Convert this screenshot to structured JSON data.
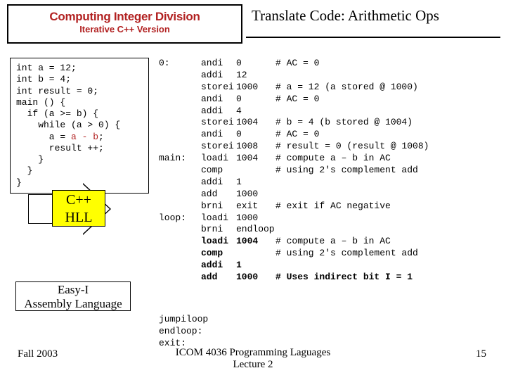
{
  "header": {
    "title_left": "Computing Integer Division",
    "subtitle_left": "Iterative C++ Version",
    "title_right": "Translate Code: Arithmetic Ops"
  },
  "cpp": {
    "l1": "int a = 12;",
    "l2": "int b = 4;",
    "l3": "int result = 0;",
    "l4": "main () {",
    "l5": "  if (a >= b) {",
    "l6": "    while (a > 0) {",
    "l7a": "      a = ",
    "l7r": "a - b",
    "l7c": ";",
    "l8": "      result ++;",
    "l9": "    }",
    "l10": "  }",
    "l11": "}"
  },
  "asm": {
    "r1": {
      "lbl": "0:",
      "op": "andi",
      "arg": "0",
      "cmt": "# AC = 0"
    },
    "r2": {
      "lbl": "",
      "op": "addi",
      "arg": "12",
      "cmt": ""
    },
    "r3": {
      "lbl": "",
      "op": "storei",
      "arg": "1000",
      "cmt": "# a = 12 (a stored @ 1000)"
    },
    "r4": {
      "lbl": "",
      "op": "andi",
      "arg": "0",
      "cmt": "# AC = 0"
    },
    "r5": {
      "lbl": "",
      "op": "addi",
      "arg": "4",
      "cmt": ""
    },
    "r6": {
      "lbl": "",
      "op": "storei",
      "arg": "1004",
      "cmt": "# b = 4 (b stored @ 1004)"
    },
    "r7": {
      "lbl": "",
      "op": "andi",
      "arg": "0",
      "cmt": "# AC = 0"
    },
    "r8": {
      "lbl": "",
      "op": "storei",
      "arg": "1008",
      "cmt": "# result = 0 (result @ 1008)"
    },
    "r9": {
      "lbl": "main:",
      "op": "loadi",
      "arg": "1004",
      "cmt": "# compute a – b in AC"
    },
    "r10": {
      "lbl": "",
      "op": "comp",
      "arg": "",
      "cmt": "# using 2's complement add"
    },
    "r11": {
      "lbl": "",
      "op": "addi",
      "arg": "1",
      "cmt": ""
    },
    "r12": {
      "lbl": "",
      "op": "add",
      "arg": "1000",
      "cmt": ""
    },
    "r13": {
      "lbl": "",
      "op": "brni",
      "arg": "exit",
      "cmt": "# exit if AC negative"
    },
    "r14": {
      "lbl": "loop:",
      "op": "loadi",
      "arg": "1000",
      "cmt": ""
    },
    "r15": {
      "lbl": "",
      "op": "brni",
      "arg": "endloop",
      "cmt": ""
    },
    "r16": {
      "lbl": "",
      "op": "loadi",
      "arg": "1004",
      "cmt": "# compute a – b in AC",
      "bold": true
    },
    "r17": {
      "lbl": "",
      "op": "comp",
      "arg": "",
      "cmt": "# using 2's complement add",
      "bold": true
    },
    "r18": {
      "lbl": "",
      "op": "addi",
      "arg": "1",
      "cmt": "",
      "bold": true
    },
    "r19": {
      "lbl": "",
      "op": "add",
      "arg": "1000",
      "cmt": "# Uses indirect bit I = 1",
      "bold": true
    }
  },
  "asm_bottom": {
    "r1": {
      "lbl": "",
      "op": "jumpi",
      "arg": "loop"
    },
    "r2": {
      "lbl": "endloop:",
      "op": "",
      "arg": ""
    },
    "r3": {
      "lbl": "exit:",
      "op": "",
      "arg": ""
    }
  },
  "labels": {
    "cpp_hll_1": "C++",
    "cpp_hll_2": "HLL",
    "easy_1": "Easy-I",
    "easy_2": "Assembly Language"
  },
  "footer": {
    "left": "Fall 2003",
    "center1": "ICOM 4036 Programming Laguages",
    "center2": "Lecture 2",
    "right": "15"
  }
}
